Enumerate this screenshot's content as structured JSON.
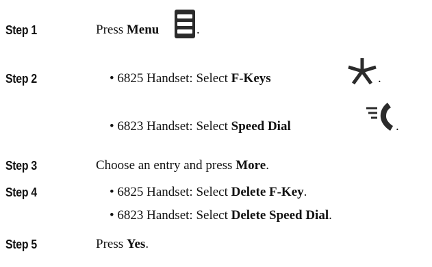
{
  "steps": [
    {
      "label": "Step 1",
      "pre": "Press ",
      "bold": "Menu",
      "post": ".",
      "icon": "menu-icon"
    },
    {
      "label": "Step 2",
      "bullets": [
        {
          "pre": "• 6825 Handset: Select ",
          "bold": "F-Keys",
          "post": ".",
          "icon": "asterisk-icon"
        },
        {
          "pre": "• 6823 Handset: Select ",
          "bold": "Speed Dial",
          "post": ".",
          "icon": "speed-dial-icon"
        }
      ]
    },
    {
      "label": "Step 3",
      "pre": "Choose an entry and press ",
      "bold": "More",
      "post": "."
    },
    {
      "label": "Step 4",
      "bullets": [
        {
          "pre": "• 6825 Handset: Select ",
          "bold": "Delete F-Key",
          "post": "."
        },
        {
          "pre": "• 6823 Handset: Select ",
          "bold": "Delete Speed Dial",
          "post": "."
        }
      ]
    },
    {
      "label": "Step 5",
      "pre": "Press ",
      "bold": "Yes",
      "post": "."
    }
  ],
  "colors": {
    "text": "#111111",
    "icon": "#2b2b2b"
  }
}
